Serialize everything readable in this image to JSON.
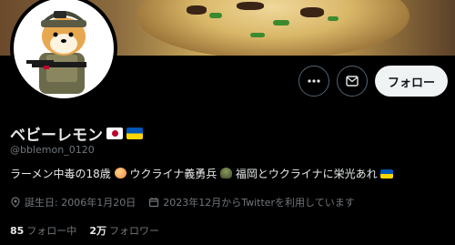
{
  "profile": {
    "display_name": "ベビーレモン",
    "handle": "@bblemon_0120",
    "bio": {
      "part1": "ラーメン中毒の18歳",
      "part2": " ウクライナ義勇兵",
      "part3": "福岡とウクライナに栄光あれ"
    },
    "birth": "誕生日: 2006年1月20日",
    "joined": "2023年12月からTwitterを利用しています"
  },
  "stats": {
    "following_count": "85",
    "following_label": "フォロー中",
    "followers_count": "2万",
    "followers_label": "フォロワー"
  },
  "actions": {
    "follow_label": "フォロー"
  },
  "icons": {
    "more": "more-icon",
    "message": "message-icon",
    "location": "location-pin-icon",
    "calendar": "calendar-icon"
  },
  "colors": {
    "background": "#000000",
    "text_primary": "#e7e9ea",
    "text_secondary": "#71767b",
    "follow_button_bg": "#eff3f4"
  }
}
